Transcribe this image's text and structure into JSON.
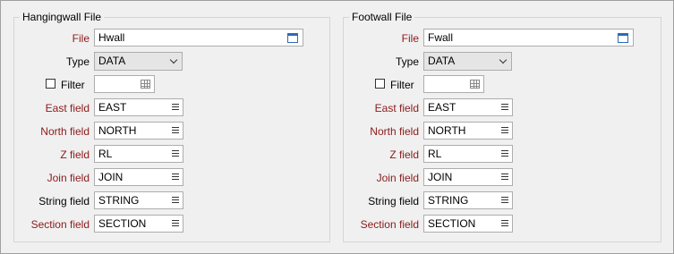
{
  "panels": [
    {
      "title": "Hangingwall File",
      "file": {
        "label": "File",
        "value": "Hwall"
      },
      "type": {
        "label": "Type",
        "value": "DATA"
      },
      "filter": {
        "label": "Filter",
        "checked": false,
        "value": ""
      },
      "fields": [
        {
          "label": "East field",
          "value": "EAST",
          "required": true
        },
        {
          "label": "North field",
          "value": "NORTH",
          "required": true
        },
        {
          "label": "Z field",
          "value": "RL",
          "required": true
        },
        {
          "label": "Join field",
          "value": "JOIN",
          "required": true
        },
        {
          "label": "String field",
          "value": "STRING",
          "required": false
        },
        {
          "label": "Section field",
          "value": "SECTION",
          "required": true
        }
      ]
    },
    {
      "title": "Footwall File",
      "file": {
        "label": "File",
        "value": "Fwall"
      },
      "type": {
        "label": "Type",
        "value": "DATA"
      },
      "filter": {
        "label": "Filter",
        "checked": false,
        "value": ""
      },
      "fields": [
        {
          "label": "East field",
          "value": "EAST",
          "required": true
        },
        {
          "label": "North field",
          "value": "NORTH",
          "required": true
        },
        {
          "label": "Z field",
          "value": "RL",
          "required": true
        },
        {
          "label": "Join field",
          "value": "JOIN",
          "required": true
        },
        {
          "label": "String field",
          "value": "STRING",
          "required": false
        },
        {
          "label": "Section field",
          "value": "SECTION",
          "required": true
        }
      ]
    }
  ],
  "colors": {
    "required_label": "#8b1a1a",
    "optional_label": "#000000"
  }
}
